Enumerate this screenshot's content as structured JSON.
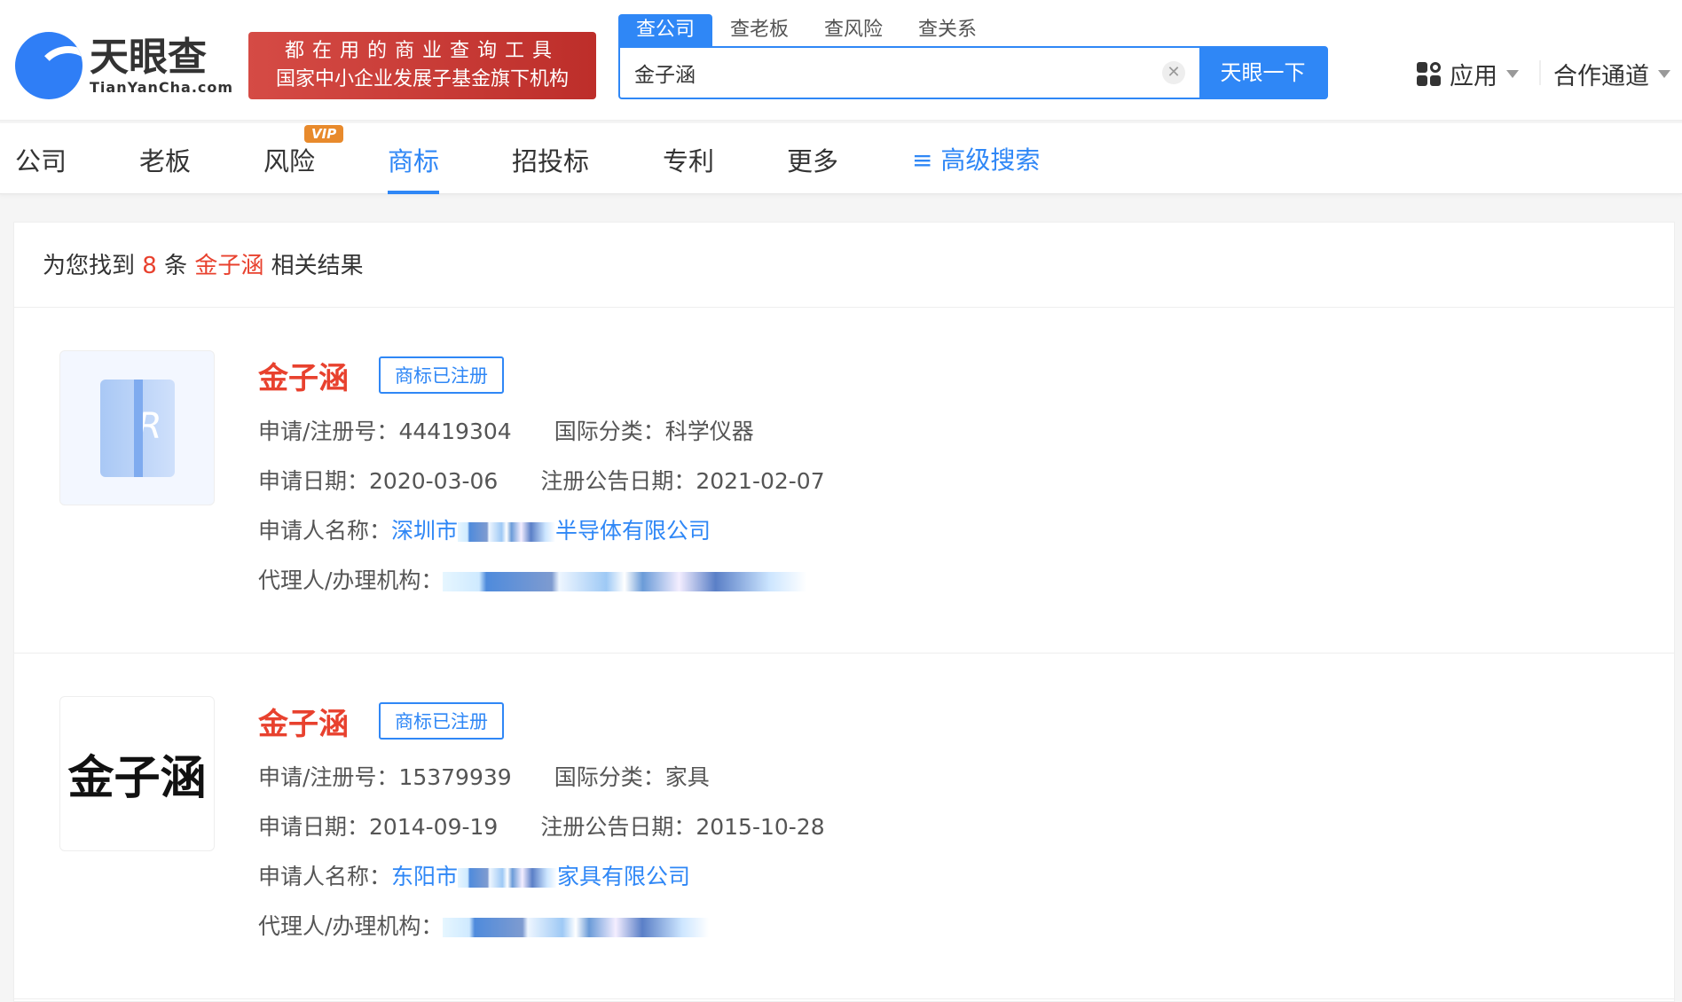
{
  "header": {
    "logo_cn": "天眼查",
    "logo_en": "TianYanCha.com",
    "banner_line1": "都在用的商业查询工具",
    "banner_line2": "国家中小企业发展子基金旗下机构",
    "search_tabs": [
      "查公司",
      "查老板",
      "查风险",
      "查关系"
    ],
    "search_value": "金子涵",
    "search_button": "天眼一下",
    "apps_label": "应用",
    "partner_label": "合作通道"
  },
  "nav": {
    "items": [
      "公司",
      "老板",
      "风险",
      "商标",
      "招投标",
      "专利",
      "更多"
    ],
    "active": "商标",
    "vip_badge": "VIP",
    "advanced_search": "高级搜索"
  },
  "summary": {
    "prefix": "为您找到",
    "count": "8",
    "unit": "条",
    "keyword": "金子涵",
    "suffix": "相关结果"
  },
  "results": [
    {
      "name": "金子涵",
      "status": "商标已注册",
      "reg_no_label": "申请/注册号：",
      "reg_no": "44419304",
      "class_label": "国际分类：",
      "class": "科学仪器",
      "apply_date_label": "申请日期：",
      "apply_date": "2020-03-06",
      "pub_date_label": "注册公告日期：",
      "pub_date": "2021-02-07",
      "applicant_label": "申请人名称：",
      "applicant_pre": "深圳市",
      "applicant_post": "半导体有限公司",
      "agent_label": "代理人/办理机构：",
      "thumb_text": ""
    },
    {
      "name": "金子涵",
      "status": "商标已注册",
      "reg_no_label": "申请/注册号：",
      "reg_no": "15379939",
      "class_label": "国际分类：",
      "class": "家具",
      "apply_date_label": "申请日期：",
      "apply_date": "2014-09-19",
      "pub_date_label": "注册公告日期：",
      "pub_date": "2015-10-28",
      "applicant_label": "申请人名称：",
      "applicant_pre": "东阳市",
      "applicant_post": "家具有限公司",
      "agent_label": "代理人/办理机构：",
      "thumb_text": "金子涵"
    }
  ]
}
